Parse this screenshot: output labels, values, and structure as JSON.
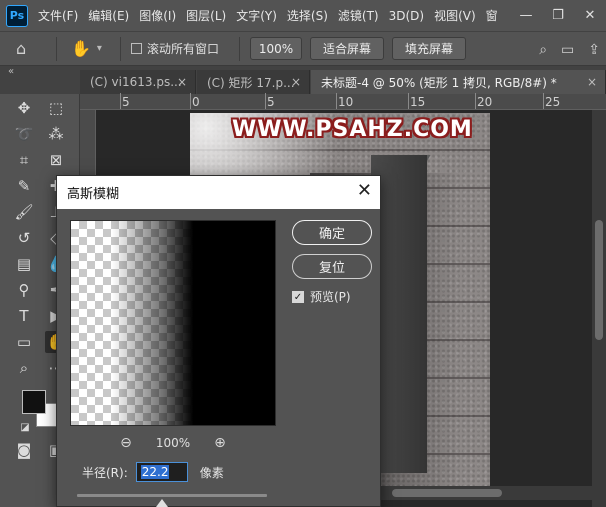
{
  "menubar": {
    "logo": "Ps",
    "items": [
      "文件(F)",
      "编辑(E)",
      "图像(I)",
      "图层(L)",
      "文字(Y)",
      "选择(S)",
      "滤镜(T)",
      "3D(D)",
      "视图(V)",
      "窗"
    ],
    "controls": {
      "minimize": "—",
      "restore": "❐",
      "close": "✕"
    }
  },
  "options_bar": {
    "scroll_all_windows_label": "滚动所有窗口",
    "zoom_value": "100%",
    "fit_screen_label": "适合屏幕",
    "fill_screen_label": "填充屏幕"
  },
  "tabs": [
    {
      "label": "(C) vi1613.ps...",
      "close": "×"
    },
    {
      "label": "(C) 矩形 17.p...",
      "close": "×"
    },
    {
      "label": "未标题-4 @ 50% (矩形 1 拷贝, RGB/8#) *",
      "close": "×"
    }
  ],
  "ruler": {
    "marks": [
      "5",
      "0",
      "5",
      "10",
      "15",
      "20",
      "25"
    ]
  },
  "canvas": {
    "watermark": "WWW.PSAHZ.COM"
  },
  "dialog": {
    "title": "高斯模糊",
    "ok_label": "确定",
    "reset_label": "复位",
    "preview_label": "预览(P)",
    "preview_checked": true,
    "zoom_level": "100%",
    "radius_label": "半径(R):",
    "radius_value": "22.2",
    "unit_label": "像素"
  },
  "colors": {
    "foreground": "#111111",
    "background": "#ffffff",
    "accent": "#31a8ff"
  }
}
